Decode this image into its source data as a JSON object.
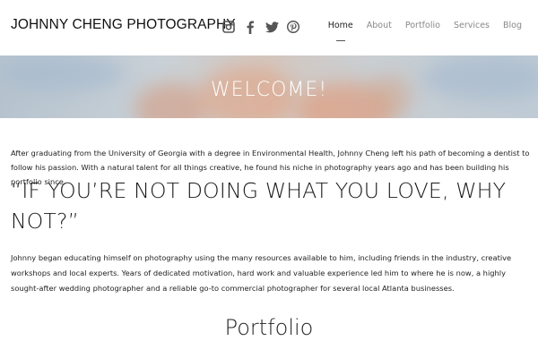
{
  "header": {
    "site_title": "JOHNNY CHENG PHOTOGRAPHY",
    "social_icons": [
      "instagram-icon",
      "facebook-icon",
      "twitter-icon",
      "pinterest-icon"
    ],
    "nav": [
      {
        "label": "Home",
        "active": true
      },
      {
        "label": "About",
        "active": false
      },
      {
        "label": "Portfolio",
        "active": false
      },
      {
        "label": "Services",
        "active": false
      },
      {
        "label": "Blog",
        "active": false
      }
    ]
  },
  "hero": {
    "title": "WELCOME!"
  },
  "content": {
    "intro": "After graduating from the University of Georgia with a degree in Environmental Health, Johnny Cheng left his path of becoming a dentist to follow his passion. With a natural talent for all things creative, he found his niche in photography years ago and has been building his portfolio since.",
    "quote": "“IF YOU’RE NOT DOING WHAT YOU LOVE, WHY NOT?”",
    "bio": "Johnny began educating himself on photography using the many resources available to him, including friends in the industry, creative workshops and local experts. Years of dedicated motivation, hard work and valuable experience led him to where he is now, a highly sought-after wedding photographer and a reliable go-to commercial photographer for several local Atlanta businesses.",
    "portfolio_heading": "Portfolio"
  },
  "colors": {
    "text": "#222222",
    "nav_inactive": "#888888",
    "hero_text": "#ffffff"
  }
}
